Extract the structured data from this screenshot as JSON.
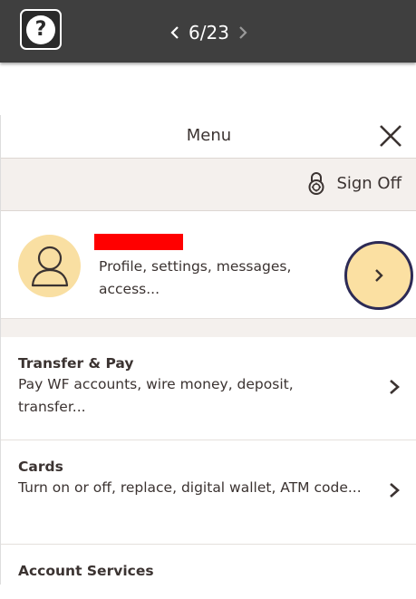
{
  "topbar": {
    "help_label": "?",
    "pager_text": "6/23"
  },
  "menu": {
    "title": "Menu",
    "signoff_label": "Sign Off",
    "profile": {
      "description": "Profile, settings, messages, access..."
    },
    "items": [
      {
        "title": "Transfer & Pay",
        "description": "Pay WF accounts, wire money, deposit, transfer..."
      },
      {
        "title": "Cards",
        "description": "Turn on or off, replace, digital wallet, ATM code..."
      },
      {
        "title": "Account Services",
        "description": ""
      }
    ]
  },
  "colors": {
    "topbar_bg": "#3f3f3f",
    "avatar_bg": "#f9dfa2",
    "highlight_ring": "#2c2a55",
    "redaction": "#ff0000",
    "band_bg": "#f4f0ed"
  },
  "icons": {
    "help": "question-icon",
    "prev": "chevron-left-icon",
    "next": "chevron-right-icon",
    "close": "close-icon",
    "signoff": "lock-icon",
    "avatar": "user-icon",
    "row_arrow": "chevron-right-icon"
  }
}
